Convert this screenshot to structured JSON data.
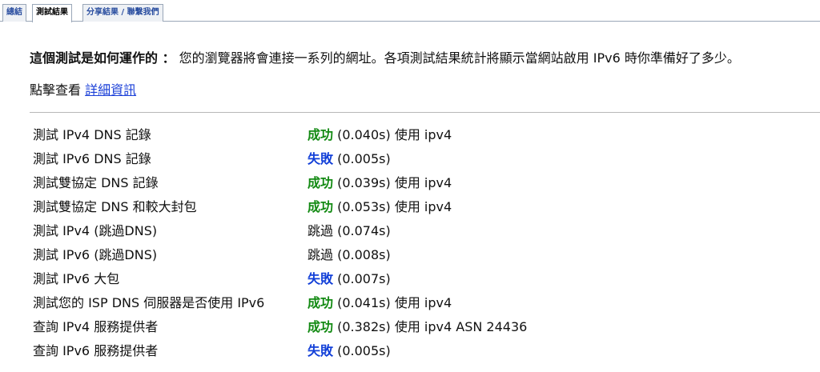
{
  "tabs": [
    {
      "label": "總結",
      "active": false
    },
    {
      "label": "測試結果",
      "active": true
    },
    {
      "label": "分享結果 / 聯繫我們",
      "active": false
    }
  ],
  "intro": {
    "lead": "這個測試是如何運作的 ：",
    "text": " 您的瀏覽器將會連接一系列的網址。各項測試結果統計將顯示當網站啟用 IPv6 時你準備好了多少。"
  },
  "detail": {
    "prefix": "點擊查看 ",
    "link": "詳細資訊"
  },
  "colors": {
    "success": "#138a13",
    "fail": "#1340d8"
  },
  "results": [
    {
      "test": "測試 IPv4 DNS 記錄",
      "status": "成功",
      "status_type": "ok",
      "detail": "(0.040s) 使用 ipv4"
    },
    {
      "test": "測試 IPv6 DNS 記錄",
      "status": "失敗",
      "status_type": "fail",
      "detail": "(0.005s)"
    },
    {
      "test": "測試雙協定 DNS 記錄",
      "status": "成功",
      "status_type": "ok",
      "detail": "(0.039s) 使用 ipv4"
    },
    {
      "test": "測試雙協定 DNS 和較大封包",
      "status": "成功",
      "status_type": "ok",
      "detail": "(0.053s) 使用 ipv4"
    },
    {
      "test": "測試 IPv4 (跳過DNS)",
      "status": "跳過",
      "status_type": "skip",
      "detail": "(0.074s)"
    },
    {
      "test": "測試 IPv6 (跳過DNS)",
      "status": "跳過",
      "status_type": "skip",
      "detail": "(0.008s)"
    },
    {
      "test": "測試 IPv6 大包",
      "status": "失敗",
      "status_type": "fail",
      "detail": "(0.007s)"
    },
    {
      "test": "測試您的 ISP DNS 伺服器是否使用 IPv6",
      "status": "成功",
      "status_type": "ok",
      "detail": "(0.041s) 使用 ipv4"
    },
    {
      "test": "查詢 IPv4 服務提供者",
      "status": "成功",
      "status_type": "ok",
      "detail": "(0.382s) 使用 ipv4 ASN 24436"
    },
    {
      "test": "查詢 IPv6 服務提供者",
      "status": "失敗",
      "status_type": "fail",
      "detail": "(0.005s)"
    }
  ]
}
